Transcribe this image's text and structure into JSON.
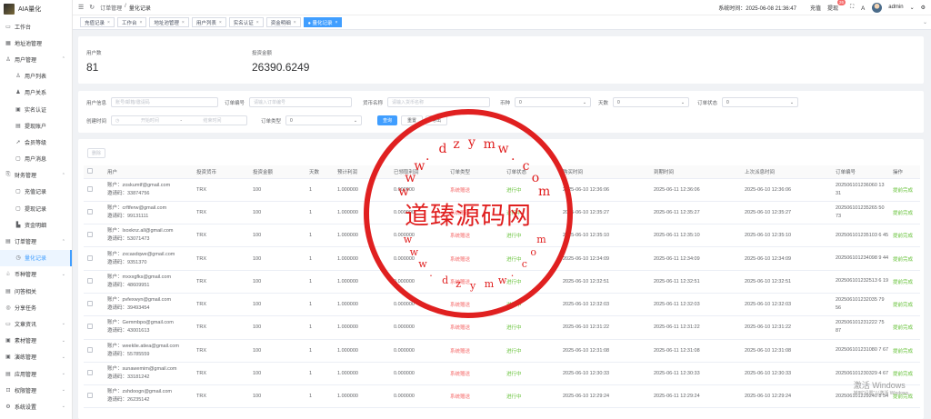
{
  "app": {
    "title": "AIA量化"
  },
  "sidebar": {
    "items": [
      {
        "label": "工作台",
        "icon": "monitor-icon",
        "glyph": "▭"
      },
      {
        "label": "地址池管理",
        "icon": "grid-icon",
        "glyph": "▦"
      },
      {
        "label": "用户管理",
        "icon": "user-icon",
        "glyph": "♙",
        "arrow": "⌃"
      },
      {
        "label": "用户列表",
        "icon": "user-list-icon",
        "glyph": "♙",
        "sub": true
      },
      {
        "label": "用户关系",
        "icon": "users-icon",
        "glyph": "♟",
        "sub": true
      },
      {
        "label": "实名认证",
        "icon": "id-card-icon",
        "glyph": "▣",
        "sub": true
      },
      {
        "label": "提现账户",
        "icon": "card-icon",
        "glyph": "▤",
        "sub": true
      },
      {
        "label": "会员等级",
        "icon": "rocket-icon",
        "glyph": "➚",
        "sub": true
      },
      {
        "label": "用户消息",
        "icon": "message-icon",
        "glyph": "▢",
        "sub": true
      },
      {
        "label": "财务管理",
        "icon": "finance-icon",
        "glyph": "⎘",
        "arrow": "⌃"
      },
      {
        "label": "充值记录",
        "icon": "deposit-icon",
        "glyph": "▢",
        "sub": true
      },
      {
        "label": "提现记录",
        "icon": "withdraw-icon",
        "glyph": "▢",
        "sub": true
      },
      {
        "label": "资金明细",
        "icon": "funds-icon",
        "glyph": "▙",
        "sub": true
      },
      {
        "label": "订单管理",
        "icon": "order-icon",
        "glyph": "▤",
        "arrow": "⌃"
      },
      {
        "label": "量化记录",
        "icon": "clock-icon",
        "glyph": "◷",
        "sub": true,
        "active": true
      },
      {
        "label": "币种管理",
        "icon": "coin-icon",
        "glyph": "♧",
        "arrow": "⌄"
      },
      {
        "label": "问答相关",
        "icon": "qa-icon",
        "glyph": "▤"
      },
      {
        "label": "分享任务",
        "icon": "share-icon",
        "glyph": "◎"
      },
      {
        "label": "文章资讯",
        "icon": "article-icon",
        "glyph": "▭",
        "arrow": "⌄"
      },
      {
        "label": "素材管理",
        "icon": "media-icon",
        "glyph": "▣",
        "arrow": "⌄"
      },
      {
        "label": "演练管理",
        "icon": "drill-icon",
        "glyph": "▣",
        "arrow": "⌄"
      },
      {
        "label": "应用管理",
        "icon": "app-icon",
        "glyph": "▤",
        "arrow": "⌄"
      },
      {
        "label": "权限管理",
        "icon": "lock-icon",
        "glyph": "⊡",
        "arrow": "⌄"
      },
      {
        "label": "系统设置",
        "icon": "settings-icon",
        "glyph": "⚙",
        "arrow": "⌄"
      }
    ]
  },
  "header": {
    "breadcrumb": [
      "订单管理",
      "/",
      "量化记录"
    ],
    "system_time": "系统时间：2025-06-08 21:36:47",
    "recharge": "充值",
    "withdraw": "提现",
    "withdraw_badge": "26",
    "admin": "admin"
  },
  "tabs": [
    {
      "label": "充值记录"
    },
    {
      "label": "工作台"
    },
    {
      "label": "地址池管理"
    },
    {
      "label": "用户列表"
    },
    {
      "label": "实名认证"
    },
    {
      "label": "资金明细"
    },
    {
      "label": "● 量化记录",
      "active": true
    }
  ],
  "stats": {
    "users_label": "用户数",
    "users_value": "81",
    "amount_label": "投资金额",
    "amount_value": "26390.6249"
  },
  "filters": {
    "user_info_label": "用户信息",
    "user_info_ph": "账号/邮箱/邀请码",
    "order_no_label": "订单编号",
    "order_no_ph": "请输入订单编号",
    "coin_name_label": "货币名称",
    "coin_name_ph": "请输入货币名称",
    "currency_label": "币种",
    "currency_value": "0",
    "days_label": "天数",
    "days_value": "0",
    "order_status_label": "订单状态",
    "order_status_value": "0",
    "created_label": "创建时间",
    "start_ph": "开始时间",
    "range_sep": "-",
    "end_ph": "结束时间",
    "order_type_label": "订单类型",
    "order_type_value": "0",
    "query_btn": "查询",
    "reset_btn": "重置",
    "export_btn": "导出"
  },
  "table": {
    "delete_btn": "删除",
    "headers": [
      "",
      "用户",
      "投资货币",
      "投资金额",
      "天数",
      "预计利润",
      "已领取利润",
      "订单类型",
      "订单状态",
      "购买时间",
      "到期时间",
      "上次派息时间",
      "订单编号",
      "操作"
    ],
    "rows": [
      {
        "account": "账户：zoskumtf@gmail.com",
        "invite": "邀请码：33874756",
        "coin": "TRX",
        "amount": "100",
        "days": "1",
        "profit": "1.000000",
        "received": "0.000000",
        "type": "系统赠送",
        "status": "进行中",
        "buy": "2025-06-10 12:36:06",
        "expire": "2025-06-11 12:36:06",
        "last": "2025-06-10 12:36:06",
        "order_no": "202506101236060 13 31",
        "action": "提前完成"
      },
      {
        "account": "账户：crftferw@gmail.com",
        "invite": "邀请码：99131111",
        "coin": "TRX",
        "amount": "100",
        "days": "1",
        "profit": "1.000000",
        "received": "0.000000",
        "type": "系统赠送",
        "status": "进行中",
        "buy": "2025-06-10 12:35:27",
        "expire": "2025-06-11 12:35:27",
        "last": "2025-06-10 12:35:27",
        "order_no": "202506101235265 50 73",
        "action": "提前完成"
      },
      {
        "account": "账户：lxoxknz.all@gmail.com",
        "invite": "邀请码：53071473",
        "coin": "TRX",
        "amount": "100",
        "days": "1",
        "profit": "1.000000",
        "received": "0.000000",
        "type": "系统赠送",
        "status": "进行中",
        "buy": "2025-06-10 12:35:10",
        "expire": "2025-06-11 12:35:10",
        "last": "2025-06-10 12:35:10",
        "order_no": "202506101235103 6 45",
        "action": "提前完成"
      },
      {
        "account": "账户：zxcasdqwe@gmail.com",
        "invite": "邀请码：9351370",
        "coin": "TRX",
        "amount": "100",
        "days": "1",
        "profit": "1.000000",
        "received": "0.000000",
        "type": "系统赠送",
        "status": "进行中",
        "buy": "2025-06-10 12:34:09",
        "expire": "2025-06-11 12:34:09",
        "last": "2025-06-10 12:34:09",
        "order_no": "202506101234098 9 44",
        "action": "提前完成"
      },
      {
        "account": "账户：mxxxgfks@gmail.com",
        "invite": "邀请码：48609951",
        "coin": "TRX",
        "amount": "100",
        "days": "1",
        "profit": "1.000000",
        "received": "0.000000",
        "type": "系统赠送",
        "status": "进行中",
        "buy": "2025-06-10 12:32:51",
        "expire": "2025-06-11 12:32:51",
        "last": "2025-06-10 12:32:51",
        "order_no": "202506101232513 6 19",
        "action": "提前完成"
      },
      {
        "account": "账户：pvfexwyn@gmail.com",
        "invite": "邀请码：39493454",
        "coin": "TRX",
        "amount": "100",
        "days": "1",
        "profit": "1.000000",
        "received": "0.000000",
        "type": "系统赠送",
        "status": "进行中",
        "buy": "2025-06-10 12:32:03",
        "expire": "2025-06-11 12:32:03",
        "last": "2025-06-10 12:32:03",
        "order_no": "202506101232035 79 56",
        "action": "提前完成"
      },
      {
        "account": "账户：Gemmbpo@gmail.com",
        "invite": "邀请码：43001613",
        "coin": "TRX",
        "amount": "100",
        "days": "1",
        "profit": "1.000000",
        "received": "0.000000",
        "type": "系统赠送",
        "status": "进行中",
        "buy": "2025-06-10 12:31:22",
        "expire": "2025-06-11 12:31:22",
        "last": "2025-06-10 12:31:22",
        "order_no": "202506101231222 75 87",
        "action": "提前完成"
      },
      {
        "account": "账户：weeklie.atiea@gmail.com",
        "invite": "邀请码：55785559",
        "coin": "TRX",
        "amount": "100",
        "days": "1",
        "profit": "1.000000",
        "received": "0.000000",
        "type": "系统赠送",
        "status": "进行中",
        "buy": "2025-06-10 12:31:08",
        "expire": "2025-06-11 12:31:08",
        "last": "2025-06-10 12:31:08",
        "order_no": "202506101231080 7 67",
        "action": "提前完成"
      },
      {
        "account": "账户：sunawemim@gmail.com",
        "invite": "邀请码：33181242",
        "coin": "TRX",
        "amount": "100",
        "days": "1",
        "profit": "1.000000",
        "received": "0.000000",
        "type": "系统赠送",
        "status": "进行中",
        "buy": "2025-06-10 12:30:33",
        "expire": "2025-06-11 12:30:33",
        "last": "2025-06-10 12:30:33",
        "order_no": "202506101230329 4 67",
        "action": "提前完成"
      },
      {
        "account": "账户：zshdoogn@gmail.com",
        "invite": "邀请码：26235142",
        "coin": "TRX",
        "amount": "100",
        "days": "1",
        "profit": "1.000000",
        "received": "0.000000",
        "type": "系统赠送",
        "status": "进行中",
        "buy": "2025-06-10 12:29:24",
        "expire": "2025-06-11 12:29:24",
        "last": "2025-06-10 12:29:24",
        "order_no": "202506101229240 8 54",
        "action": "提前完成"
      }
    ]
  },
  "watermark": {
    "text": "道臻源码网",
    "url": "www.dzymw.com"
  },
  "os_notice": {
    "title": "激活 Windows",
    "sub": "转到\"设置\"以激活 Windows。"
  },
  "colors": {
    "primary": "#409eff",
    "danger": "#f56c6c",
    "success": "#67c23a",
    "watermark": "#e02020"
  }
}
